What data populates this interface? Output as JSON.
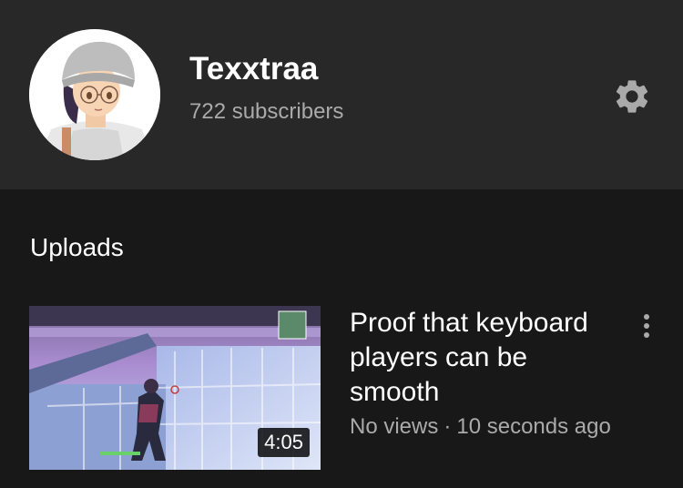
{
  "channel": {
    "name": "Texxtraa",
    "subscribers": "722 subscribers",
    "avatar_icon": "avatar-illustration",
    "settings_icon": "gear-icon"
  },
  "uploads": {
    "section_title": "Uploads",
    "videos": [
      {
        "title": "Proof that keyboard players can be smooth",
        "views": "No views",
        "separator": "·",
        "age": "10 seconds ago",
        "duration": "4:05",
        "more_icon": "more-vert-icon"
      }
    ]
  },
  "colors": {
    "background": "#181818",
    "header_background": "#282828",
    "primary_text": "#ffffff",
    "secondary_text": "#aaaaaa"
  }
}
